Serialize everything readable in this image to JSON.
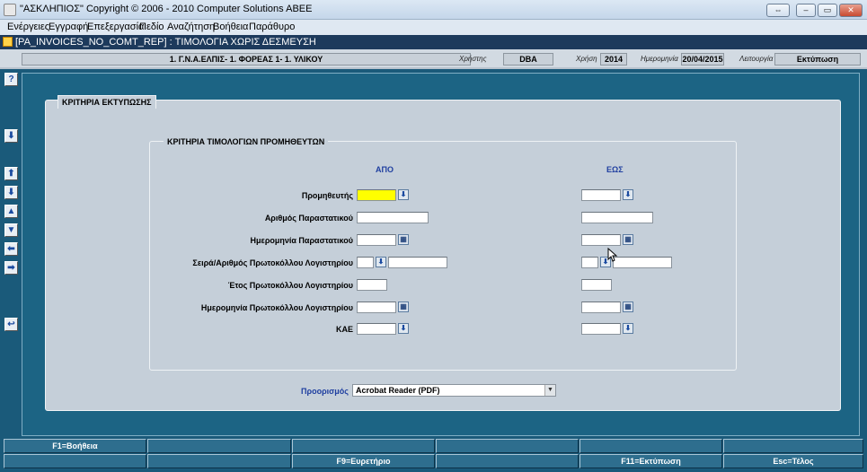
{
  "window": {
    "title": "\"ΑΣΚΛΗΠΙΟΣ\" Copyright © 2006 - 2010 Computer Solutions ABEE",
    "btn_restore": "⇔",
    "btn_min": "‒",
    "btn_max": "▭",
    "btn_close": "✕"
  },
  "menu": [
    "Ενέργειες",
    "Εγγραφή",
    "Επεξεργασία",
    "Πεδίο",
    "Αναζήτηση",
    "Βοήθεια",
    "Παράθυρο"
  ],
  "form": {
    "title": "[PA_INVOICES_NO_COMT_REP]   :  ΤΙΜΟΛΟΓΙΑ ΧΩΡΙΣ ΔΕΣΜΕΥΣΗ"
  },
  "header": {
    "org": "1. Γ.Ν.Α.ΕΛΠΙΣ- 1. ΦΟΡΕΑΣ 1- 1. ΥΛΙΚΟΥ",
    "user_label": "Χρήστης",
    "user": "DBA",
    "year_label": "Χρήση",
    "year": "2014",
    "date_label": "Ημερομηνία",
    "date": "20/04/2015",
    "mode_label": "Λειτουργία",
    "mode": "Εκτύπωση"
  },
  "side": {
    "help": "?",
    "b1": "⬇",
    "b2": "⬆",
    "b3": "⬇",
    "b4": "▲",
    "b5": "▼",
    "b6": "⬅",
    "b7": "➡",
    "b8": "↩"
  },
  "panel": {
    "title": "ΚΡΙΤΗΡΙΑ ΕΚΤΥΠΩΣΗΣ"
  },
  "group": {
    "title": "ΚΡΙΤΗΡΙΑ ΤΙΜΟΛΟΓΙΩΝ ΠΡΟΜΗΘΕΥΤΩΝ",
    "from": "ΑΠΟ",
    "to": "ΕΩΣ"
  },
  "fields": {
    "supplier": "Προμηθευτής",
    "doc_no": "Αριθμός Παραστατικού",
    "doc_date": "Ημερομηνία Παραστατικού",
    "series": "Σειρά/Αριθμός Πρωτοκόλλου Λογιστηρίου",
    "year": "Έτος Πρωτοκόλλου Λογιστηρίου",
    "prot_date": "Ημερομηνία Πρωτοκόλλου Λογιστηρίου",
    "kae": "ΚΑΕ"
  },
  "btn_glyph": "⬇",
  "cal_glyph": "▦",
  "destination": {
    "label": "Προορισμός",
    "value": "Acrobat Reader (PDF)",
    "arrow": "▼"
  },
  "footer": {
    "row1": [
      "F1=Βοήθεια",
      "",
      "",
      "",
      "",
      ""
    ],
    "row2": [
      "",
      "",
      "F9=Ευρετήριο",
      "",
      "F11=Εκτύπωση",
      "Esc=Τέλος"
    ]
  }
}
